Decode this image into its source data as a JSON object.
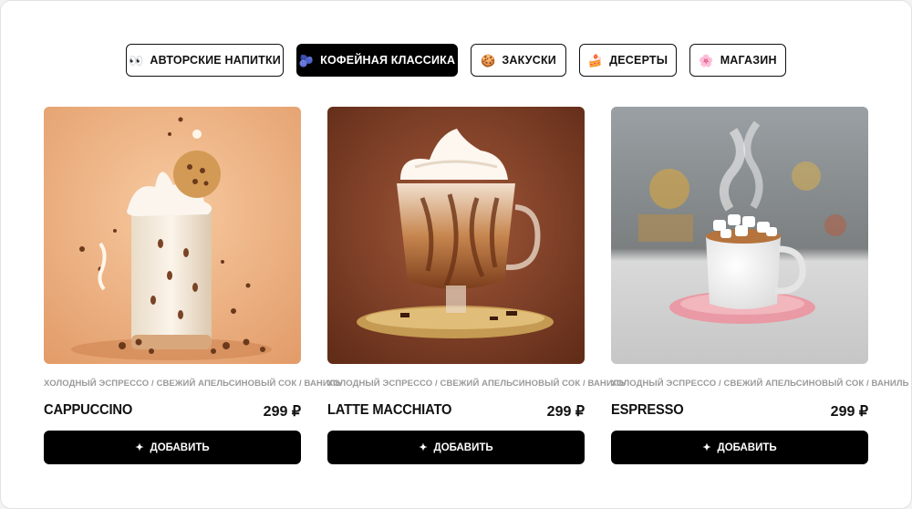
{
  "tabs": [
    {
      "label": "АВТОРСКИЕ НАПИТКИ",
      "icon": "eyes-icon",
      "glyph": "👀",
      "active": false
    },
    {
      "label": "КОФЕЙНАЯ КЛАССИКА",
      "icon": "coffee-icon",
      "glyph": "🫐",
      "active": true
    },
    {
      "label": "ЗАКУСКИ",
      "icon": "cookie-icon",
      "glyph": "🍪",
      "active": false
    },
    {
      "label": "ДЕСЕРТЫ",
      "icon": "cake-icon",
      "glyph": "🍰",
      "active": false
    },
    {
      "label": "МАГАЗИН",
      "icon": "flower-icon",
      "glyph": "🌸",
      "active": false
    }
  ],
  "products": [
    {
      "name": "CAPPUCCINO",
      "price": "299 ₽",
      "ingredients": "ХОЛОДНЫЙ ЭСПРЕССО / СВЕЖИЙ АПЕЛЬСИНОВЫЙ СОК / ВАНИЛЬ",
      "button": "ДОБАВИТЬ",
      "button_icon": "✦"
    },
    {
      "name": "LATTE MACCHIATO",
      "price": "299 ₽",
      "ingredients": "ХОЛОДНЫЙ ЭСПРЕССО / СВЕЖИЙ АПЕЛЬСИНОВЫЙ СОК / ВАНИЛЬ",
      "button": "ДОБАВИТЬ",
      "button_icon": "✦"
    },
    {
      "name": "ESPRESSO",
      "price": "299 ₽",
      "ingredients": "ХОЛОДНЫЙ ЭСПРЕССО / СВЕЖИЙ АПЕЛЬСИНОВЫЙ СОК / ВАНИЛЬ",
      "button": "ДОБАВИТЬ",
      "button_icon": "✦"
    }
  ],
  "colors": {
    "accent": "#000000",
    "muted_text": "#9a9a9a",
    "text": "#111111"
  }
}
